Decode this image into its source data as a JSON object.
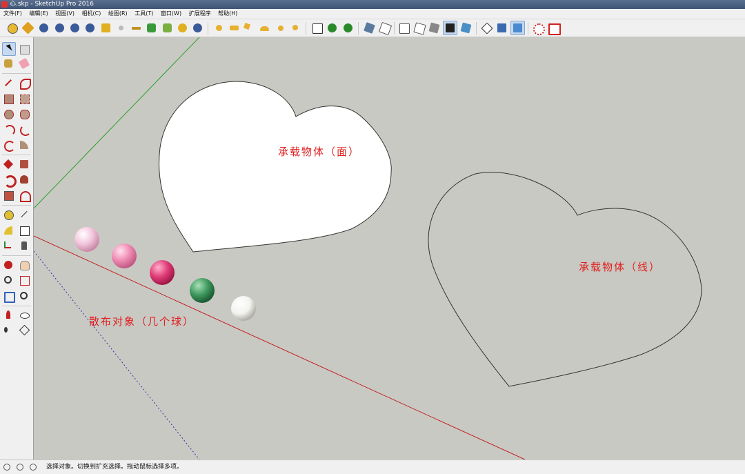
{
  "window": {
    "title": "心.skp - SketchUp Pro 2016"
  },
  "menu": [
    "文件(F)",
    "编辑(E)",
    "视图(V)",
    "相机(C)",
    "绘图(R)",
    "工具(T)",
    "窗口(W)",
    "扩展程序",
    "帮助(H)"
  ],
  "toolbar": {
    "groups": [
      [
        "M",
        "paint",
        "R",
        "RT",
        "BR",
        "help",
        "tag",
        "dot",
        "x",
        "tree",
        "plant",
        "ring",
        "pause"
      ],
      [
        "sphere",
        "hat",
        "flag",
        "dome",
        "sphere2",
        "curl"
      ],
      [
        "window",
        "shade",
        "shade2"
      ],
      [
        "box",
        "box2"
      ],
      [
        "cube-outline",
        "cube-outline2",
        "cube-solid",
        "stack",
        "cube-blue"
      ],
      [
        "cross",
        "cube-tool",
        "cube-tool-active"
      ],
      [
        "gear-red",
        "window-red"
      ]
    ]
  },
  "colors": {
    "canvas": "#c9c9c3",
    "label": "#e02020",
    "x_axis": "#c02020",
    "y_axis": "#2aa02a",
    "z_axis_dashed": "#3030b0"
  },
  "viewport": {
    "labels": {
      "face": "承载物体（面）",
      "line": "承载物体（线）",
      "scatter": "散布对象（几个球）"
    },
    "spheres": [
      {
        "name": "sphere-light-pink",
        "color": "#f2c6dc"
      },
      {
        "name": "sphere-pink",
        "color": "#f08cb4"
      },
      {
        "name": "sphere-magenta",
        "color": "#e03c78"
      },
      {
        "name": "sphere-green",
        "color": "#3f9a5e"
      },
      {
        "name": "sphere-white",
        "color": "#f2f2ee"
      }
    ]
  },
  "status": {
    "message": "选择对象。切换到扩充选择。拖动鼠标选择多项。"
  }
}
